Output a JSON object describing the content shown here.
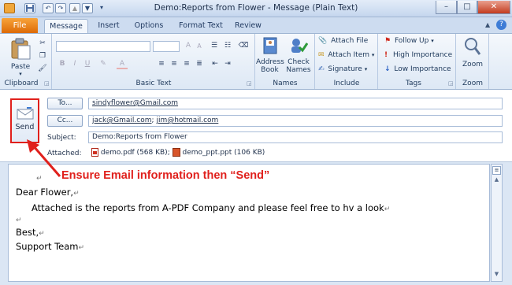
{
  "window": {
    "title": "Demo:Reports from Flower - Message (Plain Text)",
    "buttons": {
      "minimize": "–",
      "maximize": "□",
      "close": "✕"
    }
  },
  "quick_access": {
    "save": "save-icon",
    "undo": "↶",
    "redo": "↷",
    "up": "▲",
    "down": "▼",
    "more": "▾"
  },
  "tabs": [
    {
      "label": "File"
    },
    {
      "label": "Message",
      "active": true
    },
    {
      "label": "Insert"
    },
    {
      "label": "Options"
    },
    {
      "label": "Format Text"
    },
    {
      "label": "Review"
    }
  ],
  "ribbon": {
    "clipboard": {
      "paste": "Paste",
      "label": "Clipboard"
    },
    "basic_text": {
      "label": "Basic Text",
      "bold": "B",
      "italic": "I",
      "underline": "U",
      "font_color": "A"
    },
    "names": {
      "address_book": [
        "Address",
        "Book"
      ],
      "check_names": [
        "Check",
        "Names"
      ],
      "label": "Names"
    },
    "include": {
      "attach_file": "Attach File",
      "attach_item": "Attach Item",
      "signature": "Signature",
      "label": "Include"
    },
    "tags": {
      "follow_up": "Follow Up",
      "high_importance": "High Importance",
      "low_importance": "Low Importance",
      "label": "Tags"
    },
    "zoom": {
      "zoom": "Zoom",
      "label": "Zoom"
    }
  },
  "header": {
    "send": "Send",
    "to_button": "To...",
    "to_value": "sindyflower@Gmail.com",
    "cc_button": "Cc...",
    "cc_value_1": "jack@Gmail.com",
    "cc_sep": ";",
    "cc_value_2": "jim@hotmail.com",
    "subject_label": "Subject:",
    "subject_value": "Demo:Reports from Flower",
    "attached_label": "Attached:",
    "attachments": [
      {
        "name": "demo.pdf (568 KB);"
      },
      {
        "name": "demo_ppt.ppt (106 KB)"
      }
    ]
  },
  "body": {
    "pilcrow": "↵",
    "greeting": "Dear Flower,",
    "line1": "Attached is the reports from A-PDF Company and please feel free to hv a look",
    "closing": "Best,",
    "signature": "Support Team"
  },
  "annotation": {
    "text": "Ensure Email information then “Send”",
    "color": "#e0201c"
  },
  "colors": {
    "file_tab": "#e8790f",
    "accent": "#1e395b",
    "highlight": "#e0201c"
  }
}
